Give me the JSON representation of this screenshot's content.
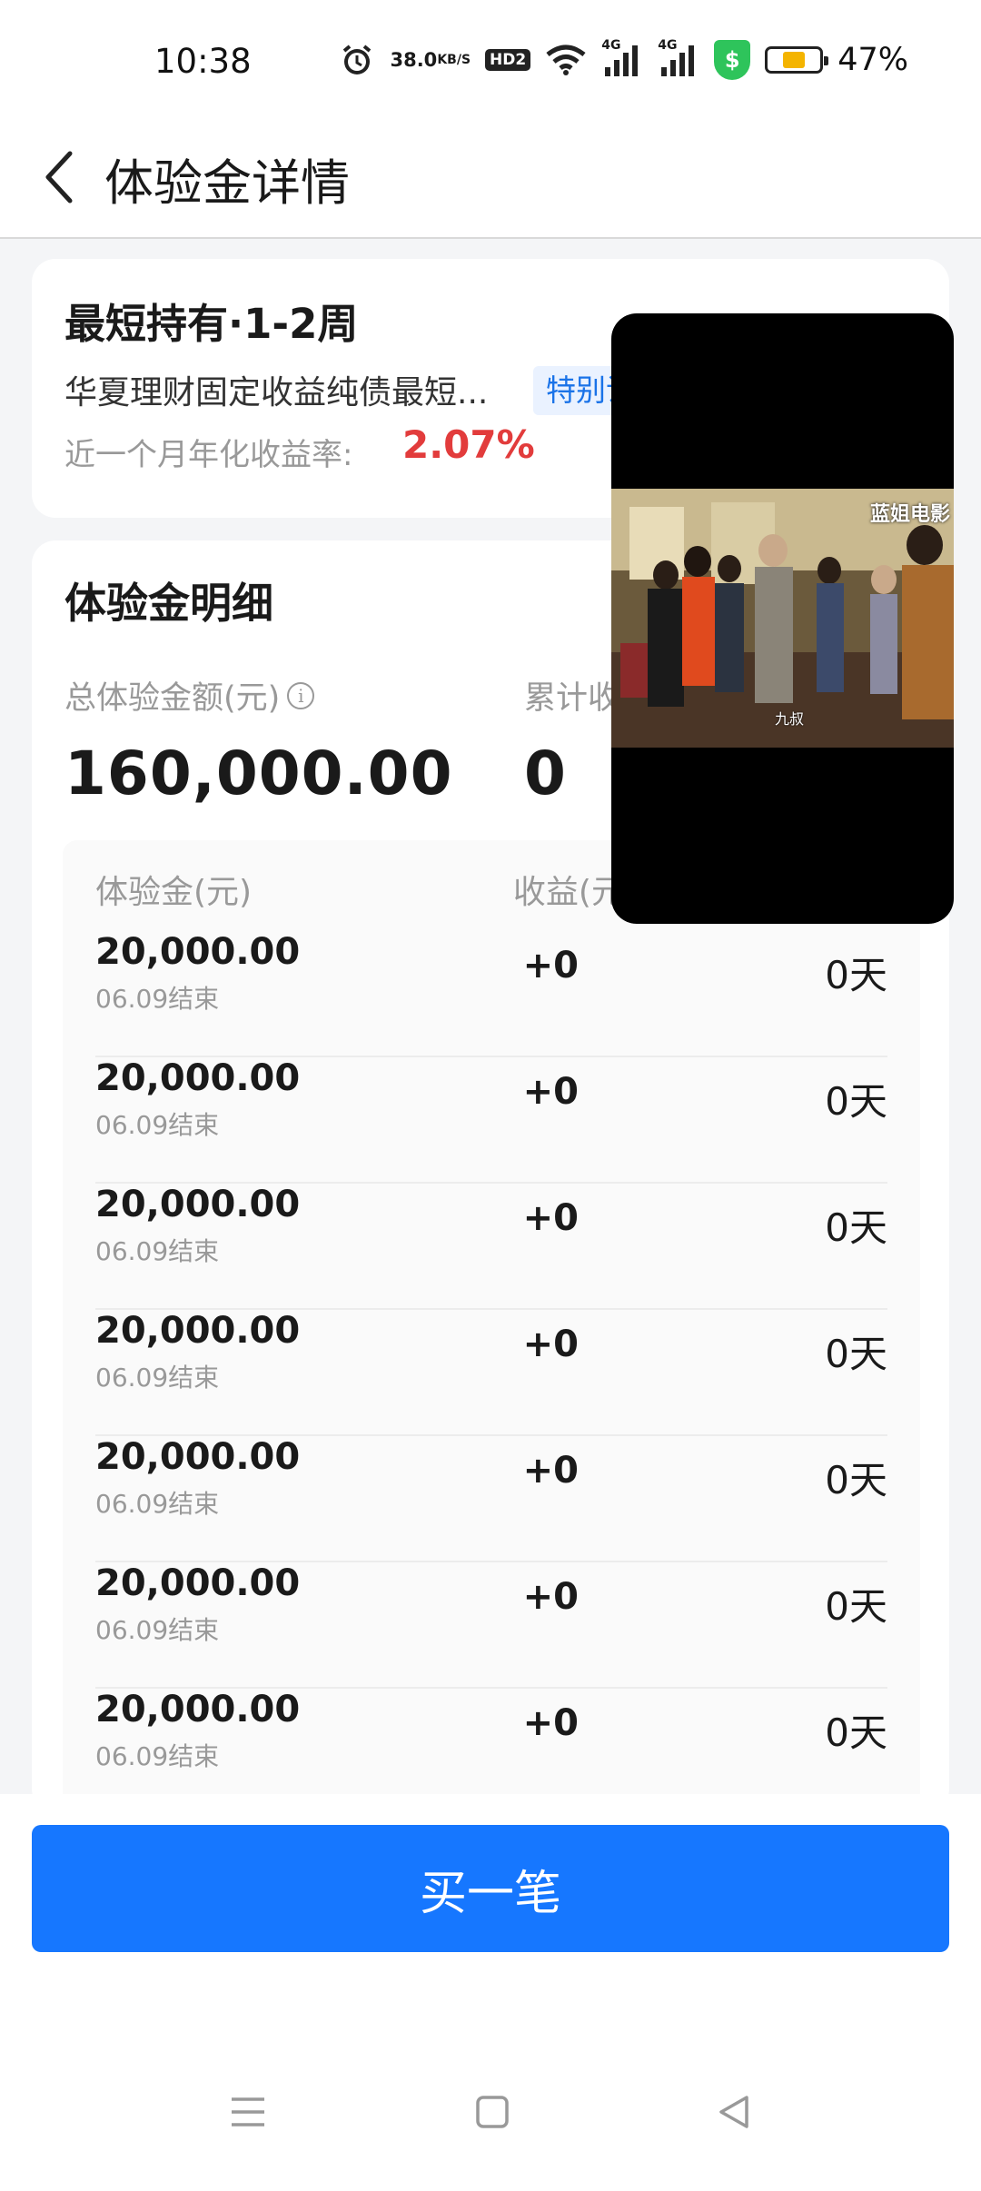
{
  "status_bar": {
    "time": "10:38",
    "net_speed_value": "38.0",
    "net_speed_unit": "KB/S",
    "hd_label": "HD2",
    "signal1_label": "4G",
    "signal2_label": "4G",
    "battery_percent": "47%",
    "battery_level": 0.47
  },
  "nav": {
    "title": "体验金详情"
  },
  "product": {
    "title": "最短持有·1-2周",
    "name": "华夏理财固定收益纯债最短...",
    "tag": "特别说",
    "rate_label": "近一个月年化收益率:",
    "rate_value": "2.07%",
    "rate_color": "#e23c3c"
  },
  "detail": {
    "title": "体验金明细",
    "total_label": "总体验金额(元)",
    "total_value": "160,000.00",
    "cumulative_label": "累计收",
    "cumulative_value": "0",
    "columns": {
      "amount": "体验金(元)",
      "income": "收益(元)"
    },
    "rows": [
      {
        "amount": "20,000.00",
        "end": "06.09结束",
        "income": "+0",
        "days": "0天"
      },
      {
        "amount": "20,000.00",
        "end": "06.09结束",
        "income": "+0",
        "days": "0天"
      },
      {
        "amount": "20,000.00",
        "end": "06.09结束",
        "income": "+0",
        "days": "0天"
      },
      {
        "amount": "20,000.00",
        "end": "06.09结束",
        "income": "+0",
        "days": "0天"
      },
      {
        "amount": "20,000.00",
        "end": "06.09结束",
        "income": "+0",
        "days": "0天"
      },
      {
        "amount": "20,000.00",
        "end": "06.09结束",
        "income": "+0",
        "days": "0天"
      },
      {
        "amount": "20,000.00",
        "end": "06.09结束",
        "income": "+0",
        "days": "0天"
      }
    ]
  },
  "pip_video": {
    "watermark": "蓝姐电影",
    "subtitle": "九叔"
  },
  "footer": {
    "buy_label": "买一笔",
    "accent_color": "#1677ff"
  },
  "system_nav": {
    "icons": [
      "menu-icon",
      "home-icon",
      "back-triangle-icon"
    ]
  }
}
